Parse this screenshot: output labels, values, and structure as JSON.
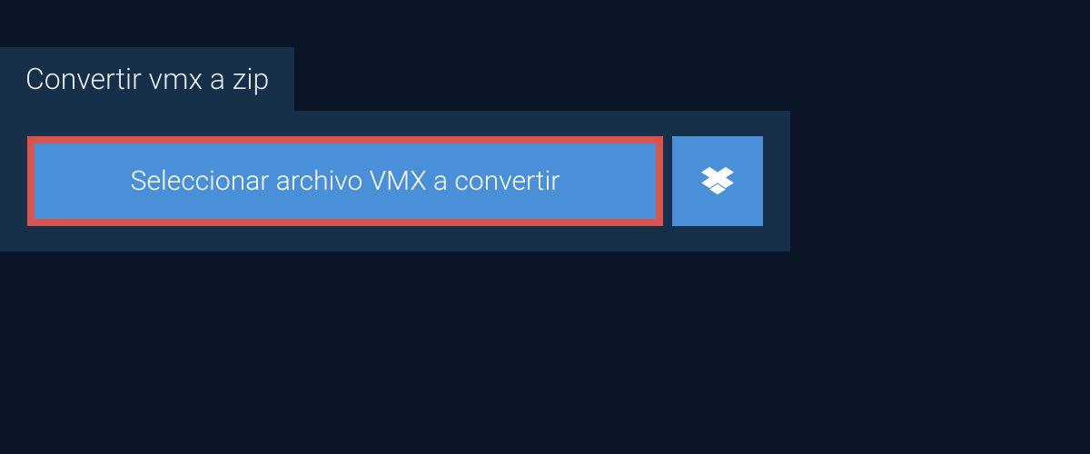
{
  "tab": {
    "title": "Convertir vmx a zip"
  },
  "buttons": {
    "select_file_label": "Seleccionar archivo VMX a convertir"
  },
  "colors": {
    "background": "#0a1628",
    "panel": "#16304a",
    "button_primary": "#4a90d9",
    "button_border_highlight": "#d9534f",
    "text_light": "#ffffff",
    "text_tab": "#e8edf2"
  }
}
